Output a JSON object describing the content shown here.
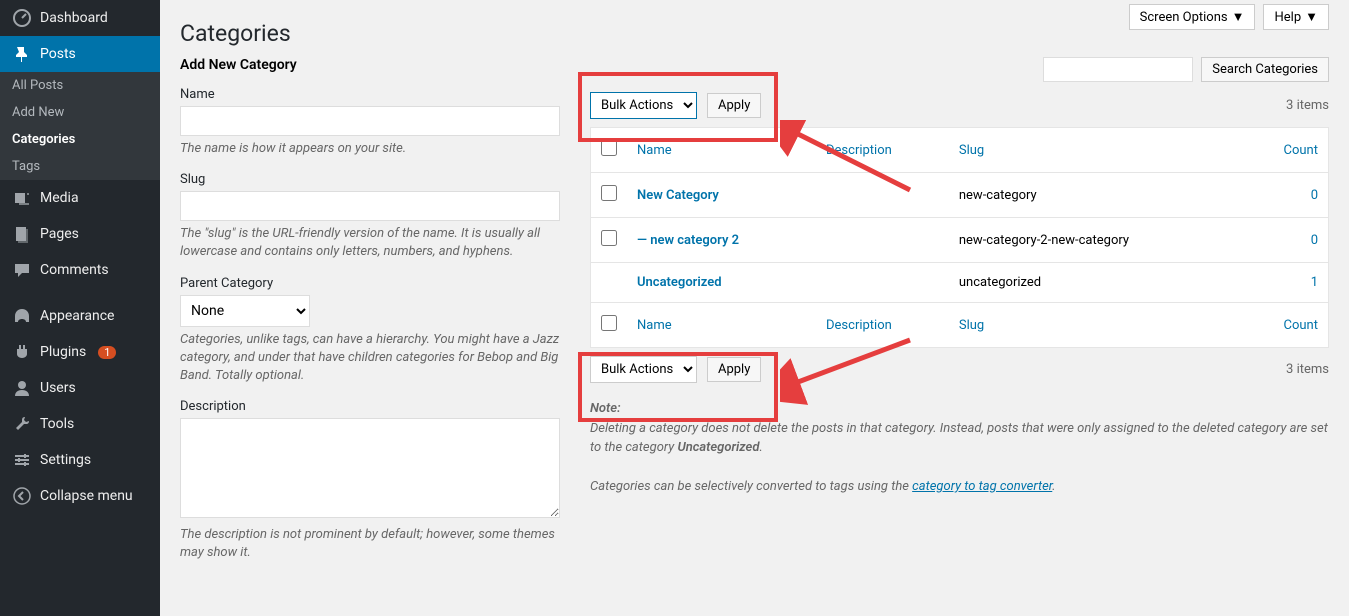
{
  "topbar": {
    "screen_options": "Screen Options",
    "help": "Help"
  },
  "sidebar": {
    "dashboard": "Dashboard",
    "posts": "Posts",
    "sub": {
      "all_posts": "All Posts",
      "add_new": "Add New",
      "categories": "Categories",
      "tags": "Tags"
    },
    "media": "Media",
    "pages": "Pages",
    "comments": "Comments",
    "appearance": "Appearance",
    "plugins": "Plugins",
    "plugins_badge": "1",
    "users": "Users",
    "tools": "Tools",
    "settings": "Settings",
    "collapse": "Collapse menu"
  },
  "page": {
    "title": "Categories",
    "add_heading": "Add New Category",
    "name_label": "Name",
    "name_help": "The name is how it appears on your site.",
    "slug_label": "Slug",
    "slug_help": "The \"slug\" is the URL-friendly version of the name. It is usually all lowercase and contains only letters, numbers, and hyphens.",
    "parent_label": "Parent Category",
    "parent_none": "None",
    "parent_help": "Categories, unlike tags, can have a hierarchy. You might have a Jazz category, and under that have children categories for Bebop and Big Band. Totally optional.",
    "desc_label": "Description",
    "desc_help": "The description is not prominent by default; however, some themes may show it."
  },
  "list": {
    "search_btn": "Search Categories",
    "bulk_actions": "Bulk Actions",
    "apply": "Apply",
    "items_count": "3 items",
    "cols": {
      "name": "Name",
      "description": "Description",
      "slug": "Slug",
      "count": "Count"
    },
    "rows": [
      {
        "name": "New Category",
        "description": "",
        "slug": "new-category",
        "count": "0",
        "check": true,
        "link": true
      },
      {
        "name": "— new category 2",
        "description": "",
        "slug": "new-category-2-new-category",
        "count": "0",
        "check": true,
        "link": true
      },
      {
        "name": "Uncategorized",
        "description": "",
        "slug": "uncategorized",
        "count": "1",
        "check": false,
        "link": true
      }
    ],
    "note_label": "Note:",
    "note1a": "Deleting a category does not delete the posts in that category. Instead, posts that were only assigned to the deleted category are set to the category ",
    "note1b": "Uncategorized",
    "note2a": "Categories can be selectively converted to tags using the ",
    "note2b": "category to tag converter"
  }
}
